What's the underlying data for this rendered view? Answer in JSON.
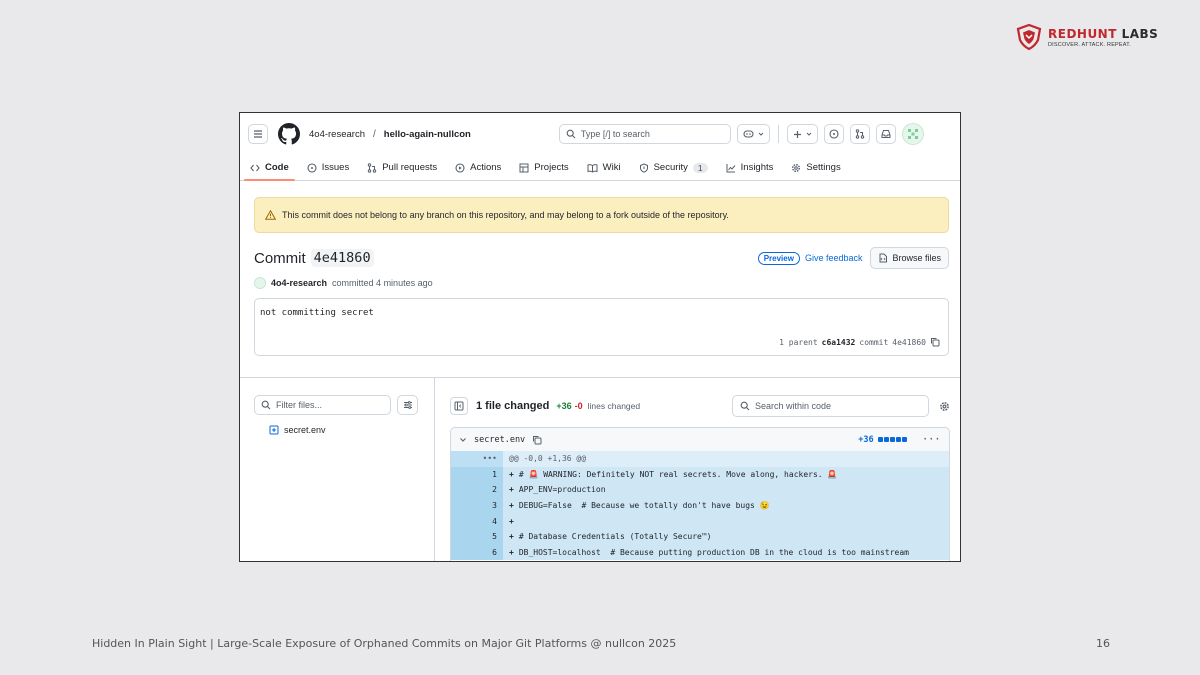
{
  "slide": {
    "brand_name_a": "REDHUNT",
    "brand_name_b": " LABS",
    "brand_tagline": "DISCOVER. ATTACK. REPEAT.",
    "footer": "Hidden In Plain Sight | Large-Scale Exposure of Orphaned Commits on Major Git Platforms @ nullcon 2025",
    "page_number": "16",
    "brand_color": "#c0282d"
  },
  "header": {
    "owner": "4o4-research",
    "separator": "/",
    "repo": "hello-again-nullcon",
    "search_placeholder": "Type [/] to search"
  },
  "tabs": [
    {
      "label": "Code",
      "icon": "code-icon",
      "active": true
    },
    {
      "label": "Issues",
      "icon": "issue-icon"
    },
    {
      "label": "Pull requests",
      "icon": "pull-request-icon"
    },
    {
      "label": "Actions",
      "icon": "play-icon"
    },
    {
      "label": "Projects",
      "icon": "table-icon"
    },
    {
      "label": "Wiki",
      "icon": "book-icon"
    },
    {
      "label": "Security",
      "icon": "shield-icon",
      "count": "1"
    },
    {
      "label": "Insights",
      "icon": "graph-icon"
    },
    {
      "label": "Settings",
      "icon": "gear-icon"
    }
  ],
  "flash": {
    "message": "This commit does not belong to any branch on this repository, and may belong to a fork outside of the repository."
  },
  "commit": {
    "title": "Commit",
    "sha": "4e41860",
    "preview_badge": "Preview",
    "give_feedback": "Give feedback",
    "browse_files": "Browse files",
    "author": "4o4-research",
    "committed_text": "committed 4 minutes ago",
    "message": "not committing secret",
    "parent_label": "1 parent",
    "parent_sha": "c6a1432",
    "commit_label": "commit",
    "commit_sha": "4e41860"
  },
  "sidebar": {
    "filter_placeholder": "Filter files...",
    "files": [
      "secret.env"
    ]
  },
  "diff": {
    "files_changed": "1 file changed",
    "additions": "+36",
    "deletions": "-0",
    "lines_changed": "lines changed",
    "search_placeholder": "Search within code",
    "file_name": "secret.env",
    "file_additions": "+36",
    "hunk_marker": "•••",
    "hunk_header": "@@ -0,0 +1,36 @@",
    "lines": [
      {
        "num": "1",
        "text": "# 🚨 WARNING: Definitely NOT real secrets. Move along, hackers. 🚨"
      },
      {
        "num": "2",
        "text": "APP_ENV=production"
      },
      {
        "num": "3",
        "text": "DEBUG=False  # Because we totally don't have bugs 😉"
      },
      {
        "num": "4",
        "text": ""
      },
      {
        "num": "5",
        "text": "# Database Credentials (Totally Secure™)"
      },
      {
        "num": "6",
        "text": "DB_HOST=localhost  # Because putting production DB in the cloud is too mainstream"
      }
    ]
  }
}
